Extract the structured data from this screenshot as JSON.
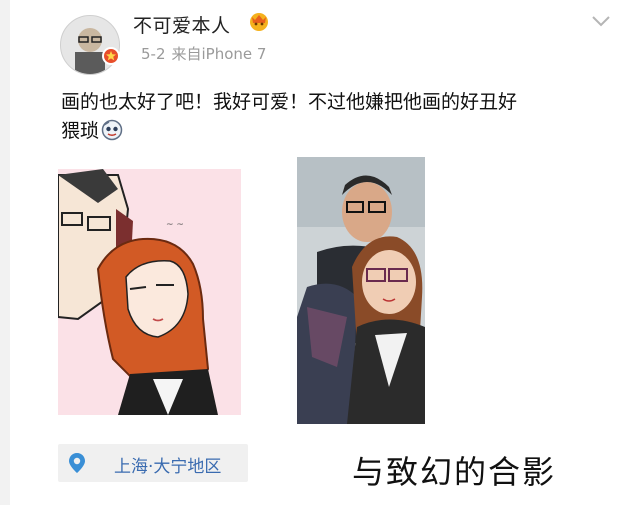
{
  "post": {
    "username": "不可爱本人",
    "date": "5-2",
    "source": "来自iPhone 7",
    "text_line1": "画的也太好了吧！我好可爱！不过他嫌把他画的好丑好",
    "text_line2": "猥琐",
    "location": "上海·大宁地区"
  },
  "overlay": {
    "caption": "与致幻的合影"
  },
  "icons": {
    "username_badge": "crown-emoji-icon",
    "verified_badge": "vip-badge-icon",
    "menu": "chevron-down-icon",
    "inline_emoji": "face-emoji-icon",
    "location": "map-pin-icon"
  },
  "colors": {
    "location_text": "#3a6bb0",
    "meta_text": "#9a9a9a",
    "badge": "#e84e2b"
  }
}
